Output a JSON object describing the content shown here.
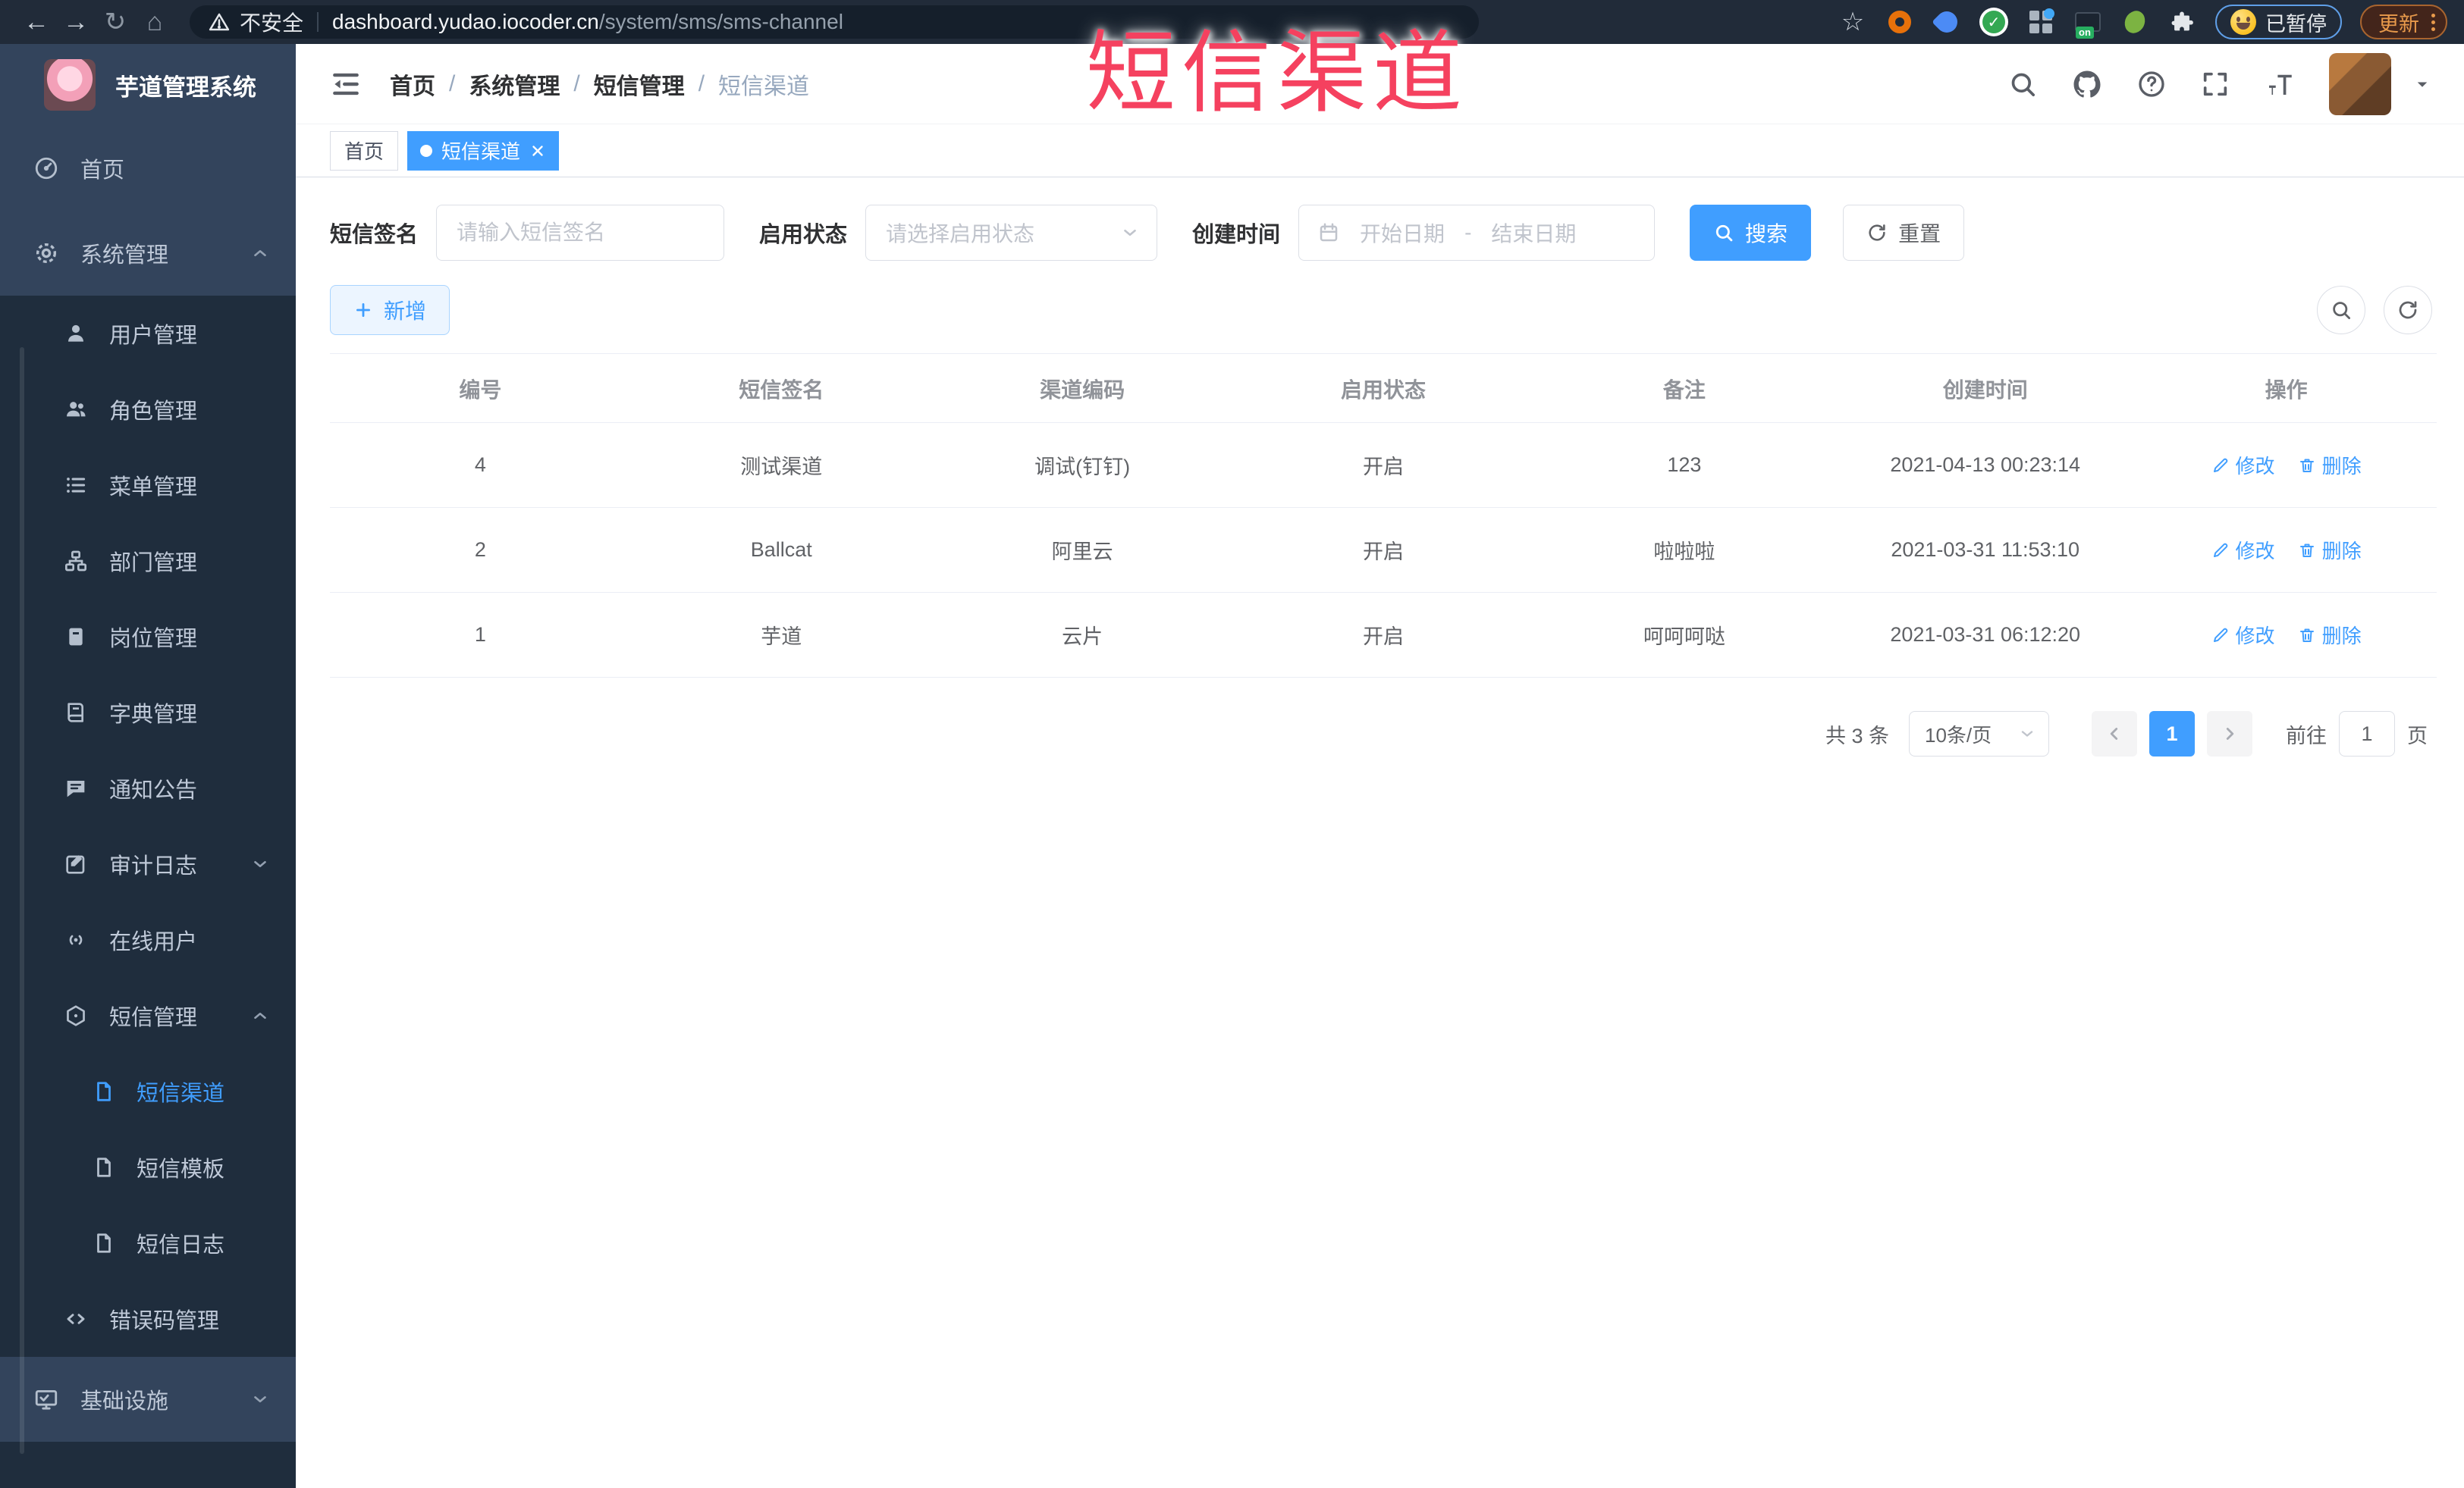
{
  "browser": {
    "security_label": "不安全",
    "url_host": "dashboard.yudao.iocoder.cn",
    "url_path": "/system/sms/sms-channel",
    "ext_on_badge": "on",
    "paused_label": "已暂停",
    "update_label": "更新"
  },
  "watermark": "短信渠道",
  "sidebar": {
    "title": "芋道管理系统",
    "items": [
      {
        "label": "首页"
      },
      {
        "label": "系统管理"
      },
      {
        "label": "用户管理"
      },
      {
        "label": "角色管理"
      },
      {
        "label": "菜单管理"
      },
      {
        "label": "部门管理"
      },
      {
        "label": "岗位管理"
      },
      {
        "label": "字典管理"
      },
      {
        "label": "通知公告"
      },
      {
        "label": "审计日志"
      },
      {
        "label": "在线用户"
      },
      {
        "label": "短信管理"
      },
      {
        "label": "短信渠道"
      },
      {
        "label": "短信模板"
      },
      {
        "label": "短信日志"
      },
      {
        "label": "错误码管理"
      },
      {
        "label": "基础设施"
      }
    ]
  },
  "breadcrumb": {
    "separator": "/",
    "items": [
      {
        "label": "首页"
      },
      {
        "label": "系统管理"
      },
      {
        "label": "短信管理"
      },
      {
        "label": "短信渠道"
      }
    ]
  },
  "tabs": [
    {
      "label": "首页"
    },
    {
      "label": "短信渠道"
    }
  ],
  "filters": {
    "sign_label": "短信签名",
    "sign_placeholder": "请输入短信签名",
    "status_label": "启用状态",
    "status_placeholder": "请选择启用状态",
    "time_label": "创建时间",
    "start_placeholder": "开始日期",
    "range_separator": "-",
    "end_placeholder": "结束日期",
    "search_label": "搜索",
    "reset_label": "重置"
  },
  "toolbar": {
    "add_label": "新增"
  },
  "table": {
    "headers": [
      "编号",
      "短信签名",
      "渠道编码",
      "启用状态",
      "备注",
      "创建时间",
      "操作"
    ],
    "edit_label": "修改",
    "delete_label": "删除",
    "rows": [
      {
        "id": "4",
        "sign": "测试渠道",
        "code": "调试(钉钉)",
        "status": "开启",
        "remark": "123",
        "created": "2021-04-13 00:23:14"
      },
      {
        "id": "2",
        "sign": "Ballcat",
        "code": "阿里云",
        "status": "开启",
        "remark": "啦啦啦",
        "created": "2021-03-31 11:53:10"
      },
      {
        "id": "1",
        "sign": "芋道",
        "code": "云片",
        "status": "开启",
        "remark": "呵呵呵哒",
        "created": "2021-03-31 06:12:20"
      }
    ]
  },
  "pagination": {
    "total": "共 3 条",
    "page_size": "10条/页",
    "current": "1",
    "goto_label": "前往",
    "goto_value": "1",
    "page_unit": "页"
  }
}
